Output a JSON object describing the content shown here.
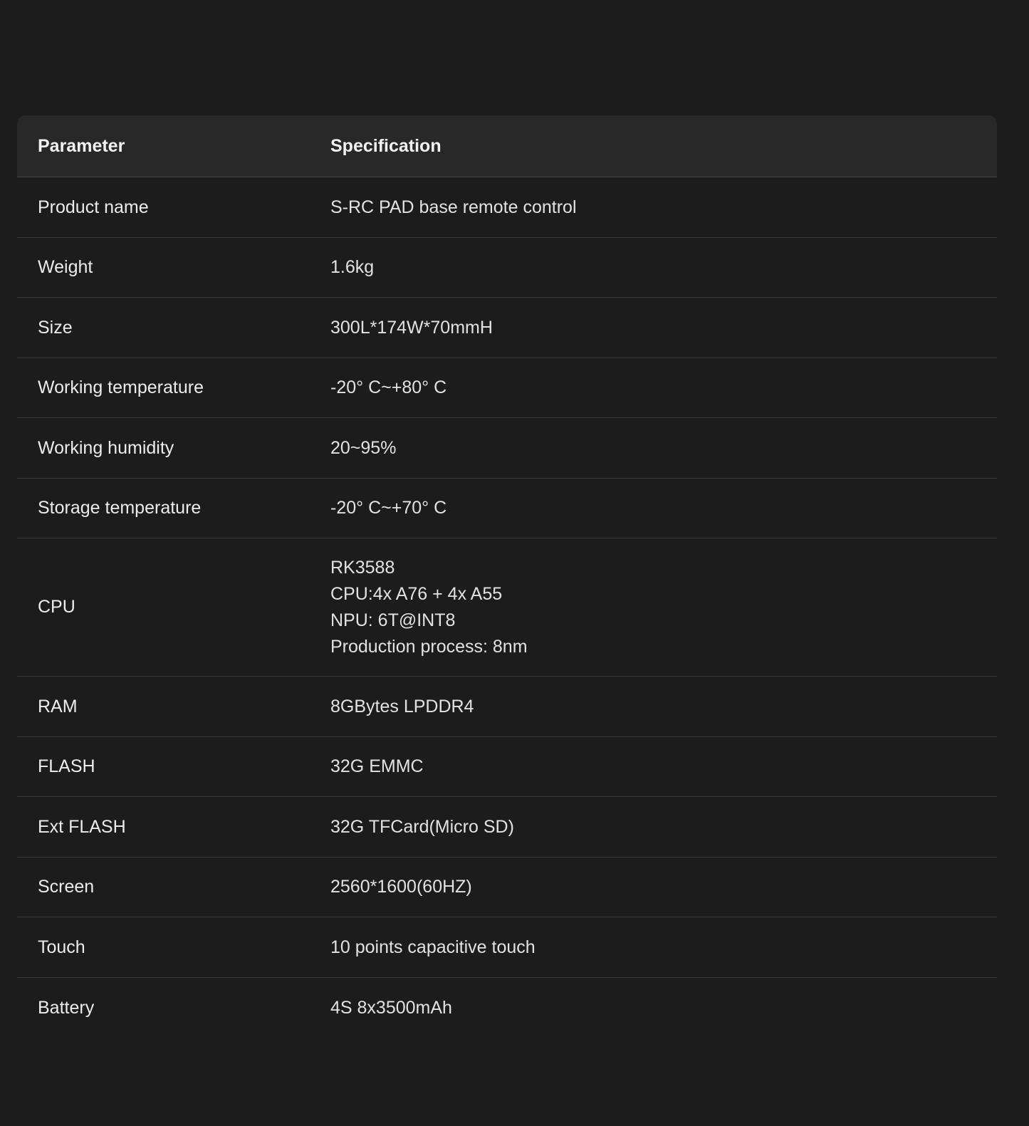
{
  "table": {
    "header": {
      "parameter": "Parameter",
      "specification": "Specification"
    },
    "rows": [
      {
        "parameter": "Product name",
        "specification": [
          "S-RC PAD base remote control"
        ]
      },
      {
        "parameter": "Weight",
        "specification": [
          "1.6kg"
        ]
      },
      {
        "parameter": "Size",
        "specification": [
          "300L*174W*70mmH"
        ]
      },
      {
        "parameter": "Working temperature",
        "specification": [
          "-20° C~+80° C"
        ]
      },
      {
        "parameter": "Working humidity",
        "specification": [
          "20~95%"
        ]
      },
      {
        "parameter": "Storage temperature",
        "specification": [
          "-20° C~+70° C"
        ]
      },
      {
        "parameter": "CPU",
        "specification": [
          "RK3588",
          "CPU:4x A76 + 4x A55",
          "NPU: 6T@INT8",
          "Production process: 8nm"
        ]
      },
      {
        "parameter": "RAM",
        "specification": [
          "8GBytes LPDDR4"
        ]
      },
      {
        "parameter": "FLASH",
        "specification": [
          "32G EMMC"
        ]
      },
      {
        "parameter": "Ext FLASH",
        "specification": [
          "32G TFCard(Micro SD)"
        ]
      },
      {
        "parameter": "Screen",
        "specification": [
          "2560*1600(60HZ)"
        ]
      },
      {
        "parameter": "Touch",
        "specification": [
          "10 points capacitive touch"
        ]
      },
      {
        "parameter": "Battery",
        "specification": [
          "4S 8x3500mAh"
        ]
      }
    ]
  }
}
